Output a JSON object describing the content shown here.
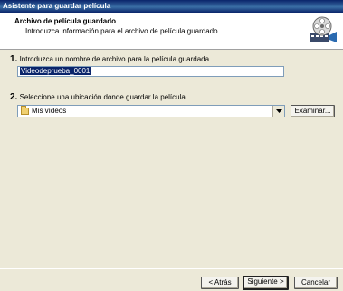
{
  "window": {
    "title": "Asistente para guardar película"
  },
  "header": {
    "title": "Archivo de película guardado",
    "subtitle": "Introduzca información para el archivo de película guardado.",
    "icon": "film-reel-icon"
  },
  "step1": {
    "number": "1.",
    "label": "Introduzca un nombre de archivo para la película guardada.",
    "filename_value": "Videodeprueba_0001"
  },
  "step2": {
    "number": "2.",
    "label": "Seleccione una ubicación donde guardar la película.",
    "location_selected": "Mis vídeos",
    "browse_label": "Examinar..."
  },
  "footer": {
    "back_label": "< Atrás",
    "next_label": "Siguiente >",
    "cancel_label": "Cancelar"
  }
}
